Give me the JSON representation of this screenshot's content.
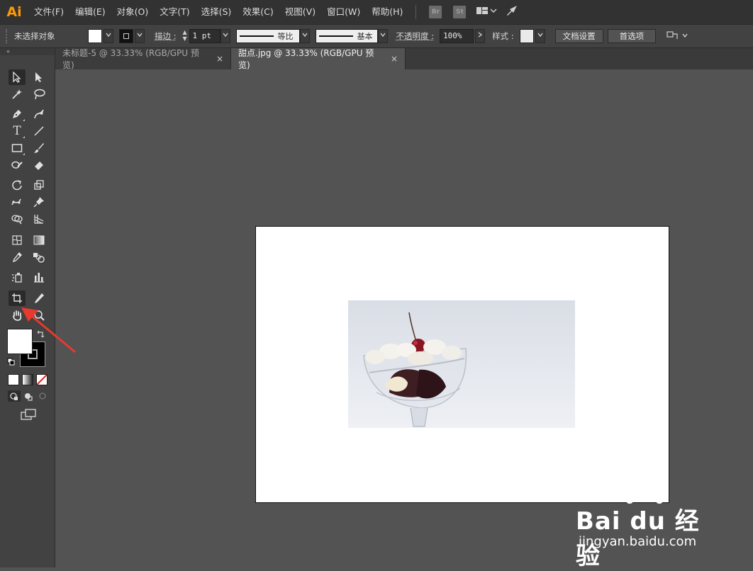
{
  "app": {
    "logo": "Ai"
  },
  "menu": [
    "文件(F)",
    "编辑(E)",
    "对象(O)",
    "文字(T)",
    "选择(S)",
    "效果(C)",
    "视图(V)",
    "窗口(W)",
    "帮助(H)"
  ],
  "menu_badges": {
    "bridge": "Br",
    "stock": "St"
  },
  "control": {
    "selection_status": "未选择对象",
    "stroke_label": "描边 :",
    "stroke_weight": "1 pt",
    "profile_label": "等比",
    "brush_label": "基本",
    "opacity_label": "不透明度 :",
    "opacity_value": "100%",
    "style_label": "样式 :",
    "doc_setup_button": "文档设置",
    "prefs_button": "首选项"
  },
  "tabs": [
    {
      "label": "未标题-5 @ 33.33% (RGB/GPU 预览)",
      "active": false,
      "close": "×"
    },
    {
      "label": "甜点.jpg @ 33.33% (RGB/GPU 预览)",
      "active": true,
      "close": "×"
    }
  ],
  "toolbar": {
    "collapse": "«"
  },
  "watermark": {
    "brand": "Bai du 经验",
    "url": "jingyan.baidu.com"
  },
  "colors": {
    "accent": "#ff9a00",
    "arrow": "#e8392f"
  }
}
